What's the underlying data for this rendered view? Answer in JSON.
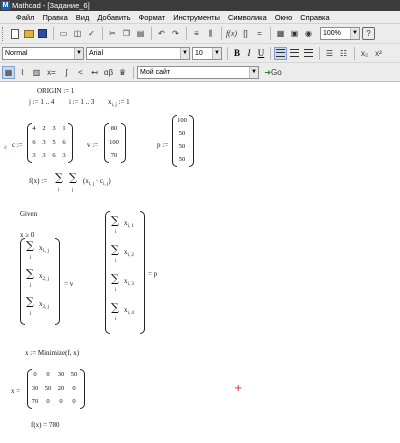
{
  "window": {
    "app_letter": "M",
    "title": "Mathcad - [Задание_6]"
  },
  "menu": [
    "Файл",
    "Правка",
    "Вид",
    "Добавить",
    "Формат",
    "Инструменты",
    "Символика",
    "Окно",
    "Справка"
  ],
  "toolbar": {
    "zoom": "100%",
    "help_icon": "?"
  },
  "format_toolbar": {
    "style": "Normal",
    "font": "Arial",
    "size": "10",
    "bold": "B",
    "italic": "I",
    "underline": "U"
  },
  "resource_toolbar": {
    "site": "Мой сайт",
    "go": "Go"
  },
  "worksheet": {
    "origin": "ORIGIN := 1",
    "ranges": [
      "j := 1 .. 4",
      "i := 1 .. 3",
      "x",
      "i, j",
      " := 1"
    ],
    "c_name": "c :=",
    "c_matrix": [
      [
        4,
        2,
        3,
        1
      ],
      [
        6,
        3,
        5,
        6
      ],
      [
        3,
        3,
        6,
        3
      ]
    ],
    "v_name": "v :=",
    "v_vector": [
      80,
      100,
      70
    ],
    "p_name": "p :=",
    "p_vector": [
      100,
      50,
      50,
      50
    ],
    "f_def": "f(x) :=",
    "f_body": "(x",
    "f_body_sub": "i, j",
    "f_body_mid": " · c",
    "f_body_sub2": "i, j",
    "f_body_end": ")",
    "given": "Given",
    "constraint": "x ≥ 0",
    "row_sums": [
      "x",
      "x",
      "x"
    ],
    "row_subs": [
      "1, j",
      "2, j",
      "3, j"
    ],
    "row_eq": "= v",
    "col_sums": [
      "x",
      "x",
      "x",
      "x"
    ],
    "col_subs": [
      "i, 1",
      "i, 2",
      "i, 3",
      "i, 4"
    ],
    "col_eq": "= p",
    "sum_idx_j": "j",
    "sum_idx_i": "i",
    "minimize": "x := Minimize(f, x)",
    "x_result_name": "x =",
    "x_result": [
      [
        0,
        0,
        30,
        50
      ],
      [
        30,
        50,
        20,
        0
      ],
      [
        70,
        0,
        0,
        0
      ]
    ],
    "f_result": "f(x) = 780",
    "sigma": "∑"
  }
}
